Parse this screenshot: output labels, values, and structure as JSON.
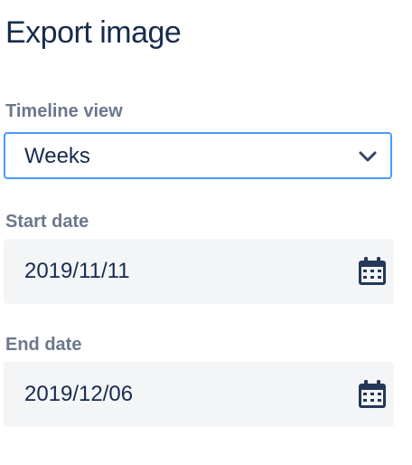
{
  "title": "Export image",
  "timeline": {
    "label": "Timeline view",
    "value": "Weeks",
    "icon": "chevron-down-icon"
  },
  "start": {
    "label": "Start date",
    "value": "2019/11/11",
    "icon": "calendar-icon"
  },
  "end": {
    "label": "End date",
    "value": "2019/12/06",
    "icon": "calendar-icon"
  },
  "colors": {
    "text": "#172b4d",
    "label": "#6b778c",
    "focus_border": "#4c9aff",
    "field_bg": "#f4f5f7"
  }
}
